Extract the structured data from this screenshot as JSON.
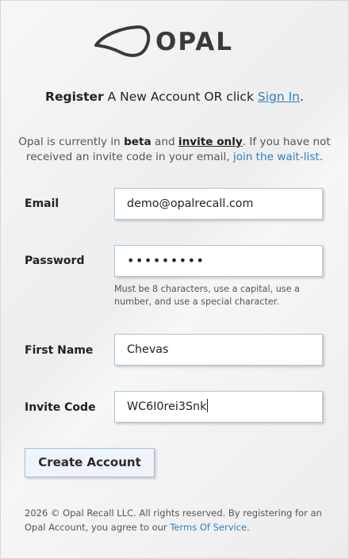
{
  "brand": {
    "logo_text": "OPAL"
  },
  "register": {
    "bold": "Register",
    "middle": " A New Account OR click ",
    "signin_link": "Sign In",
    "end": "."
  },
  "notice": {
    "pre": "Opal is currently in ",
    "beta": "beta",
    "and": " and ",
    "invite_only": "invite only",
    "post": ". If you have not received an invite code in your email, ",
    "waitlist_link": "join the wait-list",
    "end": "."
  },
  "form": {
    "email_label": "Email",
    "email_value": "demo@opalrecall.com",
    "password_label": "Password",
    "password_value": "•••••••••",
    "password_hint": "Must be 8 characters, use a capital, use a number, and use a special character.",
    "first_name_label": "First Name",
    "first_name_value": "Chevas",
    "invite_label": "Invite Code",
    "invite_value": "WC6I0rei3Snk",
    "submit_label": "Create Account"
  },
  "footer": {
    "text": "2026 © Opal Recall LLC. All rights reserved. By registering for an Opal Account, you agree to our ",
    "tos_link": "Terms Of Service",
    "end": "."
  },
  "colors": {
    "link": "#2f7fc2",
    "field_border": "#a9c6de",
    "button_bg": "#eef4fa"
  }
}
